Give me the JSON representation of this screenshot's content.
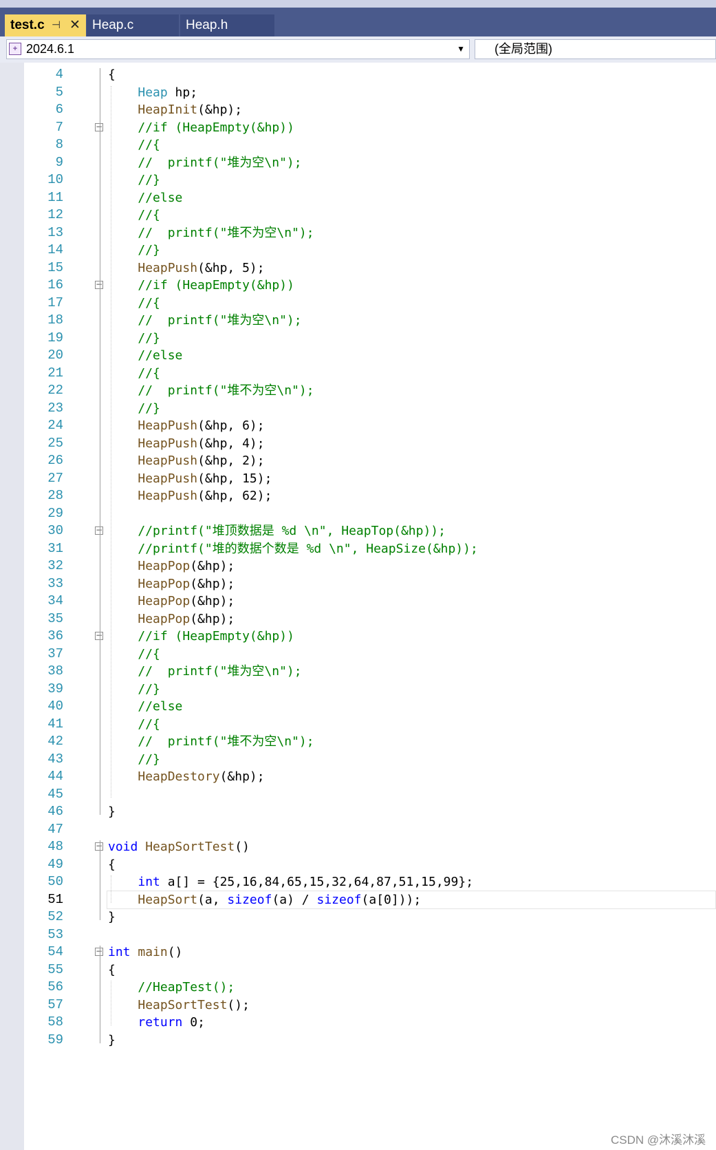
{
  "tabs": [
    {
      "label": "test.c",
      "active": true
    },
    {
      "label": "Heap.c",
      "active": false
    },
    {
      "label": "Heap.h",
      "active": false
    }
  ],
  "tab_pin_icon": "pin-icon",
  "tab_close_icon": "close-icon",
  "nav": {
    "project_value": "2024.6.1",
    "scope_value": "(全局范围)"
  },
  "current_line": 51,
  "lines": [
    {
      "n": 4,
      "segs": [
        [
          "",
          "{"
        ]
      ],
      "fold": false
    },
    {
      "n": 5,
      "segs": [
        [
          "",
          "    "
        ],
        [
          "ty",
          "Heap"
        ],
        [
          "",
          " hp;"
        ]
      ],
      "fold": false
    },
    {
      "n": 6,
      "segs": [
        [
          "",
          "    "
        ],
        [
          "fn",
          "HeapInit"
        ],
        [
          "",
          "(&hp);"
        ]
      ],
      "fold": false
    },
    {
      "n": 7,
      "segs": [
        [
          "",
          "    "
        ],
        [
          "cm",
          "//if (HeapEmpty(&hp))"
        ]
      ],
      "fold": true
    },
    {
      "n": 8,
      "segs": [
        [
          "",
          "    "
        ],
        [
          "cm",
          "//{"
        ]
      ],
      "fold": false
    },
    {
      "n": 9,
      "segs": [
        [
          "",
          "    "
        ],
        [
          "cm",
          "//  printf(\"堆为空\\n\");"
        ]
      ],
      "fold": false
    },
    {
      "n": 10,
      "segs": [
        [
          "",
          "    "
        ],
        [
          "cm",
          "//}"
        ]
      ],
      "fold": false
    },
    {
      "n": 11,
      "segs": [
        [
          "",
          "    "
        ],
        [
          "cm",
          "//else"
        ]
      ],
      "fold": false
    },
    {
      "n": 12,
      "segs": [
        [
          "",
          "    "
        ],
        [
          "cm",
          "//{"
        ]
      ],
      "fold": false
    },
    {
      "n": 13,
      "segs": [
        [
          "",
          "    "
        ],
        [
          "cm",
          "//  printf(\"堆不为空\\n\");"
        ]
      ],
      "fold": false
    },
    {
      "n": 14,
      "segs": [
        [
          "",
          "    "
        ],
        [
          "cm",
          "//}"
        ]
      ],
      "fold": false
    },
    {
      "n": 15,
      "segs": [
        [
          "",
          "    "
        ],
        [
          "fn",
          "HeapPush"
        ],
        [
          "",
          "(&hp, 5);"
        ]
      ],
      "fold": false
    },
    {
      "n": 16,
      "segs": [
        [
          "",
          "    "
        ],
        [
          "cm",
          "//if (HeapEmpty(&hp))"
        ]
      ],
      "fold": true
    },
    {
      "n": 17,
      "segs": [
        [
          "",
          "    "
        ],
        [
          "cm",
          "//{"
        ]
      ],
      "fold": false
    },
    {
      "n": 18,
      "segs": [
        [
          "",
          "    "
        ],
        [
          "cm",
          "//  printf(\"堆为空\\n\");"
        ]
      ],
      "fold": false
    },
    {
      "n": 19,
      "segs": [
        [
          "",
          "    "
        ],
        [
          "cm",
          "//}"
        ]
      ],
      "fold": false
    },
    {
      "n": 20,
      "segs": [
        [
          "",
          "    "
        ],
        [
          "cm",
          "//else"
        ]
      ],
      "fold": false
    },
    {
      "n": 21,
      "segs": [
        [
          "",
          "    "
        ],
        [
          "cm",
          "//{"
        ]
      ],
      "fold": false
    },
    {
      "n": 22,
      "segs": [
        [
          "",
          "    "
        ],
        [
          "cm",
          "//  printf(\"堆不为空\\n\");"
        ]
      ],
      "fold": false
    },
    {
      "n": 23,
      "segs": [
        [
          "",
          "    "
        ],
        [
          "cm",
          "//}"
        ]
      ],
      "fold": false
    },
    {
      "n": 24,
      "segs": [
        [
          "",
          "    "
        ],
        [
          "fn",
          "HeapPush"
        ],
        [
          "",
          "(&hp, 6);"
        ]
      ],
      "fold": false
    },
    {
      "n": 25,
      "segs": [
        [
          "",
          "    "
        ],
        [
          "fn",
          "HeapPush"
        ],
        [
          "",
          "(&hp, 4);"
        ]
      ],
      "fold": false
    },
    {
      "n": 26,
      "segs": [
        [
          "",
          "    "
        ],
        [
          "fn",
          "HeapPush"
        ],
        [
          "",
          "(&hp, 2);"
        ]
      ],
      "fold": false
    },
    {
      "n": 27,
      "segs": [
        [
          "",
          "    "
        ],
        [
          "fn",
          "HeapPush"
        ],
        [
          "",
          "(&hp, 15);"
        ]
      ],
      "fold": false
    },
    {
      "n": 28,
      "segs": [
        [
          "",
          "    "
        ],
        [
          "fn",
          "HeapPush"
        ],
        [
          "",
          "(&hp, 62);"
        ]
      ],
      "fold": false
    },
    {
      "n": 29,
      "segs": [],
      "fold": false
    },
    {
      "n": 30,
      "segs": [
        [
          "",
          "    "
        ],
        [
          "cm",
          "//printf(\"堆顶数据是 %d \\n\", HeapTop(&hp));"
        ]
      ],
      "fold": true
    },
    {
      "n": 31,
      "segs": [
        [
          "",
          "    "
        ],
        [
          "cm",
          "//printf(\"堆的数据个数是 %d \\n\", HeapSize(&hp));"
        ]
      ],
      "fold": false
    },
    {
      "n": 32,
      "segs": [
        [
          "",
          "    "
        ],
        [
          "fn",
          "HeapPop"
        ],
        [
          "",
          "(&hp);"
        ]
      ],
      "fold": false
    },
    {
      "n": 33,
      "segs": [
        [
          "",
          "    "
        ],
        [
          "fn",
          "HeapPop"
        ],
        [
          "",
          "(&hp);"
        ]
      ],
      "fold": false
    },
    {
      "n": 34,
      "segs": [
        [
          "",
          "    "
        ],
        [
          "fn",
          "HeapPop"
        ],
        [
          "",
          "(&hp);"
        ]
      ],
      "fold": false
    },
    {
      "n": 35,
      "segs": [
        [
          "",
          "    "
        ],
        [
          "fn",
          "HeapPop"
        ],
        [
          "",
          "(&hp);"
        ]
      ],
      "fold": false
    },
    {
      "n": 36,
      "segs": [
        [
          "",
          "    "
        ],
        [
          "cm",
          "//if (HeapEmpty(&hp))"
        ]
      ],
      "fold": true
    },
    {
      "n": 37,
      "segs": [
        [
          "",
          "    "
        ],
        [
          "cm",
          "//{"
        ]
      ],
      "fold": false
    },
    {
      "n": 38,
      "segs": [
        [
          "",
          "    "
        ],
        [
          "cm",
          "//  printf(\"堆为空\\n\");"
        ]
      ],
      "fold": false
    },
    {
      "n": 39,
      "segs": [
        [
          "",
          "    "
        ],
        [
          "cm",
          "//}"
        ]
      ],
      "fold": false
    },
    {
      "n": 40,
      "segs": [
        [
          "",
          "    "
        ],
        [
          "cm",
          "//else"
        ]
      ],
      "fold": false
    },
    {
      "n": 41,
      "segs": [
        [
          "",
          "    "
        ],
        [
          "cm",
          "//{"
        ]
      ],
      "fold": false
    },
    {
      "n": 42,
      "segs": [
        [
          "",
          "    "
        ],
        [
          "cm",
          "//  printf(\"堆不为空\\n\");"
        ]
      ],
      "fold": false
    },
    {
      "n": 43,
      "segs": [
        [
          "",
          "    "
        ],
        [
          "cm",
          "//}"
        ]
      ],
      "fold": false
    },
    {
      "n": 44,
      "segs": [
        [
          "",
          "    "
        ],
        [
          "fn",
          "HeapDestory"
        ],
        [
          "",
          "(&hp);"
        ]
      ],
      "fold": false
    },
    {
      "n": 45,
      "segs": [],
      "fold": false
    },
    {
      "n": 46,
      "segs": [
        [
          "",
          "}"
        ]
      ],
      "fold": false
    },
    {
      "n": 47,
      "segs": [],
      "fold": false
    },
    {
      "n": 48,
      "segs": [
        [
          "kw",
          "void"
        ],
        [
          "",
          " "
        ],
        [
          "fn",
          "HeapSortTest"
        ],
        [
          "",
          "()"
        ]
      ],
      "fold": true
    },
    {
      "n": 49,
      "segs": [
        [
          "",
          "{"
        ]
      ],
      "fold": false
    },
    {
      "n": 50,
      "segs": [
        [
          "",
          "    "
        ],
        [
          "kw",
          "int"
        ],
        [
          "",
          " a[] = {25,16,84,65,15,32,64,87,51,15,99};"
        ]
      ],
      "fold": false
    },
    {
      "n": 51,
      "segs": [
        [
          "",
          "    "
        ],
        [
          "fn",
          "HeapSort"
        ],
        [
          "",
          "(a, "
        ],
        [
          "kw",
          "sizeof"
        ],
        [
          "",
          "(a) / "
        ],
        [
          "kw",
          "sizeof"
        ],
        [
          "",
          "(a[0]));"
        ]
      ],
      "fold": false
    },
    {
      "n": 52,
      "segs": [
        [
          "",
          "}"
        ]
      ],
      "fold": false
    },
    {
      "n": 53,
      "segs": [],
      "fold": false
    },
    {
      "n": 54,
      "segs": [
        [
          "kw",
          "int"
        ],
        [
          "",
          " "
        ],
        [
          "fn",
          "main"
        ],
        [
          "",
          "()"
        ]
      ],
      "fold": true
    },
    {
      "n": 55,
      "segs": [
        [
          "",
          "{"
        ]
      ],
      "fold": false
    },
    {
      "n": 56,
      "segs": [
        [
          "",
          "    "
        ],
        [
          "cm",
          "//HeapTest();"
        ]
      ],
      "fold": false
    },
    {
      "n": 57,
      "segs": [
        [
          "",
          "    "
        ],
        [
          "fn",
          "HeapSortTest"
        ],
        [
          "",
          "();"
        ]
      ],
      "fold": false
    },
    {
      "n": 58,
      "segs": [
        [
          "",
          "    "
        ],
        [
          "kw",
          "return"
        ],
        [
          "",
          " 0;"
        ]
      ],
      "fold": false
    },
    {
      "n": 59,
      "segs": [
        [
          "",
          "}"
        ]
      ],
      "fold": false
    }
  ],
  "watermark": "CSDN @沐溪沐溪"
}
